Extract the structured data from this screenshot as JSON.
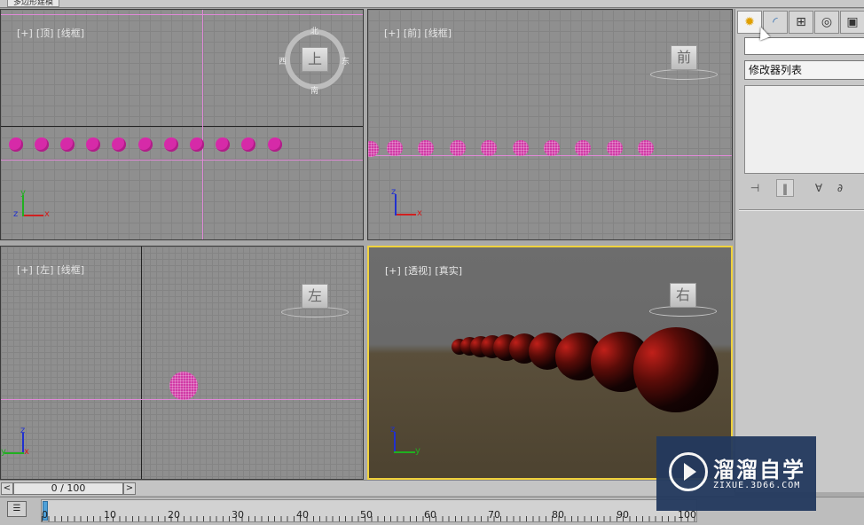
{
  "window": {
    "doc_tab": "多边形建模"
  },
  "viewports": {
    "top": {
      "label_plus": "[+]",
      "label_view": "[顶]",
      "label_mode": "[线框]",
      "viewcube_face": "上",
      "compass_n": "北",
      "compass_s": "南",
      "compass_w": "西",
      "compass_e": "东"
    },
    "front": {
      "label_plus": "[+]",
      "label_view": "[前]",
      "label_mode": "[线框]",
      "viewcube_face": "前"
    },
    "left": {
      "label_plus": "[+]",
      "label_view": "[左]",
      "label_mode": "[线框]",
      "viewcube_face": "左"
    },
    "perspective": {
      "label_plus": "[+]",
      "label_view": "[透视]",
      "label_mode": "[真实]",
      "viewcube_face": "右"
    }
  },
  "command_panel": {
    "tabs": [
      {
        "name": "create",
        "icon": "sun-star-icon"
      },
      {
        "name": "modify",
        "icon": "bend-arc-icon"
      },
      {
        "name": "hierarchy",
        "icon": "hierarchy-icon"
      },
      {
        "name": "motion",
        "icon": "motion-circle-icon"
      },
      {
        "name": "display",
        "icon": "display-monitor-icon"
      }
    ],
    "modifier_list_label": "修改器列表",
    "stack_tools": [
      "pin-icon",
      "show-end-result-icon",
      "make-unique-icon",
      "remove-modifier-icon"
    ]
  },
  "time_slider": {
    "prev": "<",
    "value": "0 / 100",
    "next": ">"
  },
  "track_bar": {
    "ticks": [
      "0",
      "10",
      "20",
      "30",
      "40",
      "50",
      "60",
      "70",
      "80",
      "90",
      "100"
    ]
  },
  "watermark": {
    "title": "溜溜自学",
    "subtitle": "ZIXUE.3D66.COM"
  },
  "colors": {
    "active_viewport_border": "#f0d23c",
    "sphere_wire": "#d62aa8",
    "axis_x": "#d02020",
    "axis_y": "#20b020",
    "axis_z": "#2030d0"
  }
}
